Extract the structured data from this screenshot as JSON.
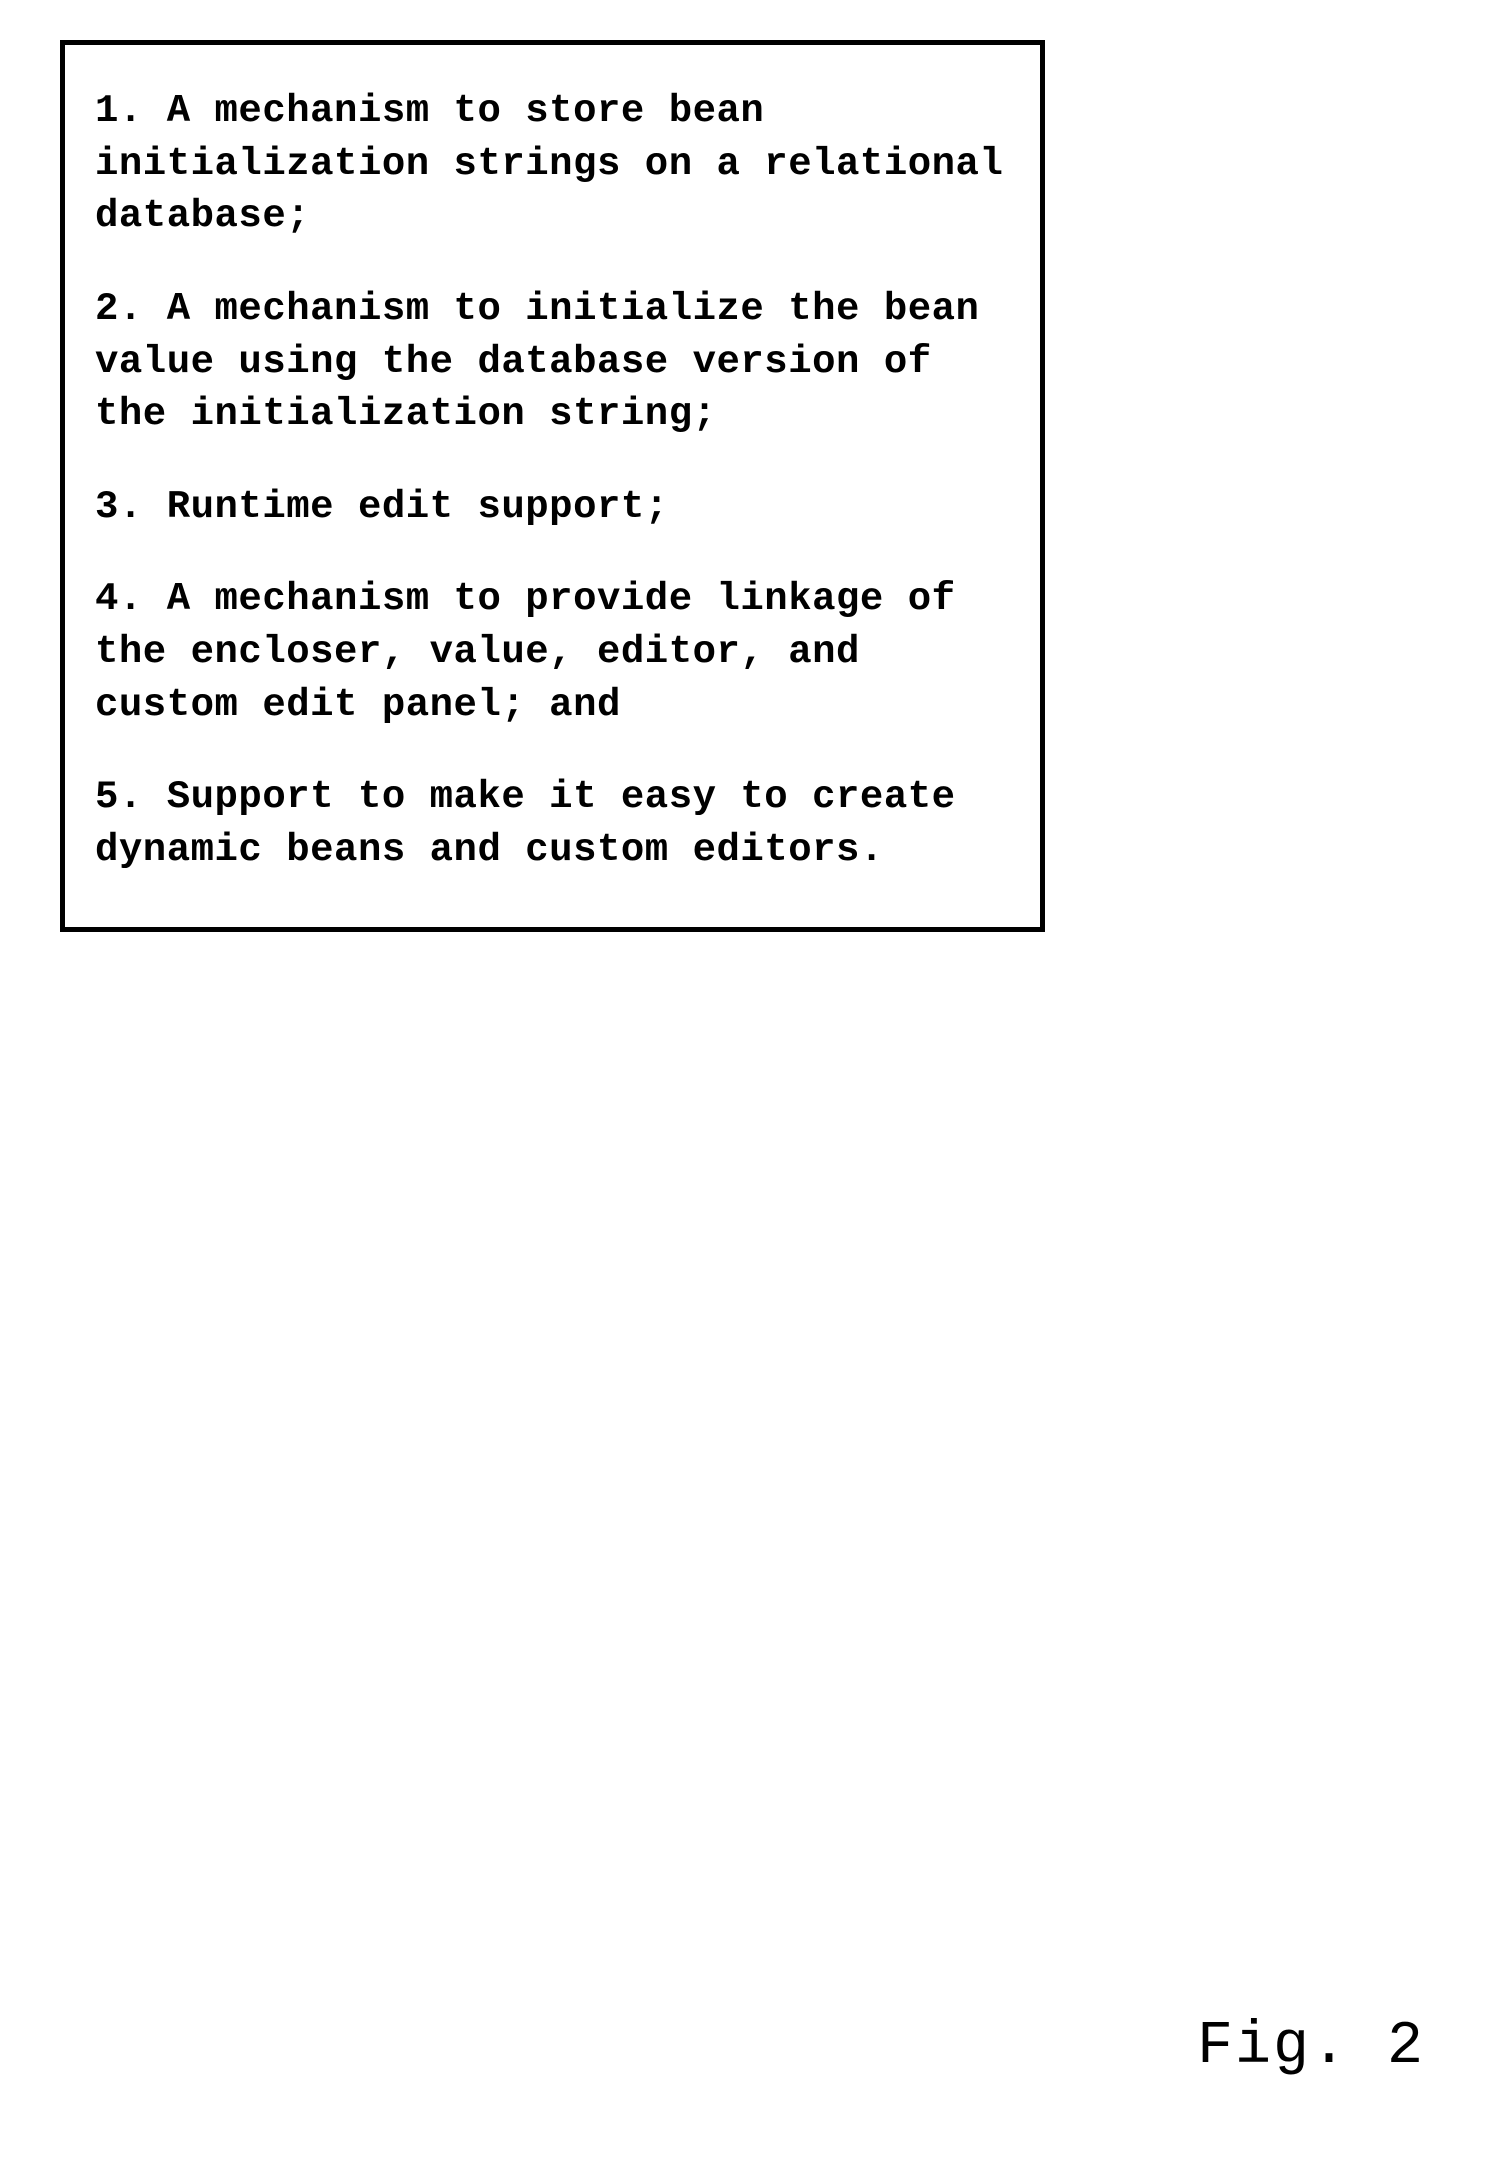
{
  "items": [
    "1. A mechanism to store bean initialization strings on a relational database;",
    "2. A mechanism to initialize the bean value using the database version of the initialization string;",
    "3. Runtime edit support;",
    "4. A mechanism to provide linkage of the encloser, value, editor, and custom edit panel; and",
    "5. Support to make it easy to create dynamic beans and custom editors."
  ],
  "figure_label": "Fig. 2"
}
